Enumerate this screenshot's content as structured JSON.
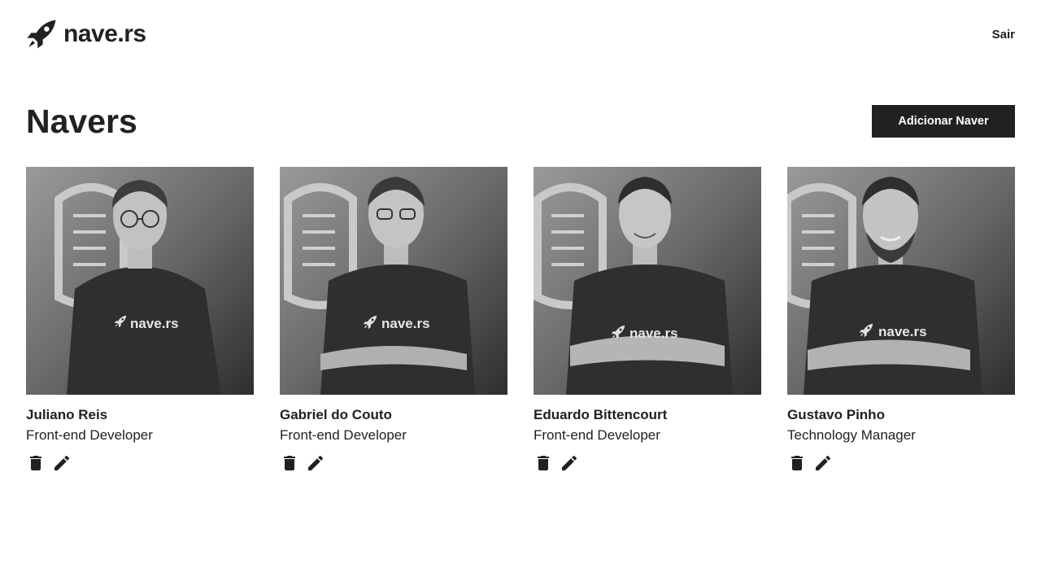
{
  "header": {
    "logo_text": "nave.rs",
    "logo_icon": "rocket-icon",
    "logout_label": "Sair"
  },
  "main": {
    "title": "Navers",
    "add_button_label": "Adicionar Naver"
  },
  "navers": [
    {
      "name": "Juliano Reis",
      "role": "Front-end Developer",
      "shirt_text": "nave.rs"
    },
    {
      "name": "Gabriel do Couto",
      "role": "Front-end Developer",
      "shirt_text": "nave.rs"
    },
    {
      "name": "Eduardo Bittencourt",
      "role": "Front-end Developer",
      "shirt_text": "nave.rs"
    },
    {
      "name": "Gustavo Pinho",
      "role": "Technology Manager",
      "shirt_text": "nave.rs"
    }
  ],
  "icons": {
    "delete": "trash-icon",
    "edit": "pencil-icon"
  },
  "colors": {
    "primary": "#212121",
    "background": "#ffffff"
  }
}
